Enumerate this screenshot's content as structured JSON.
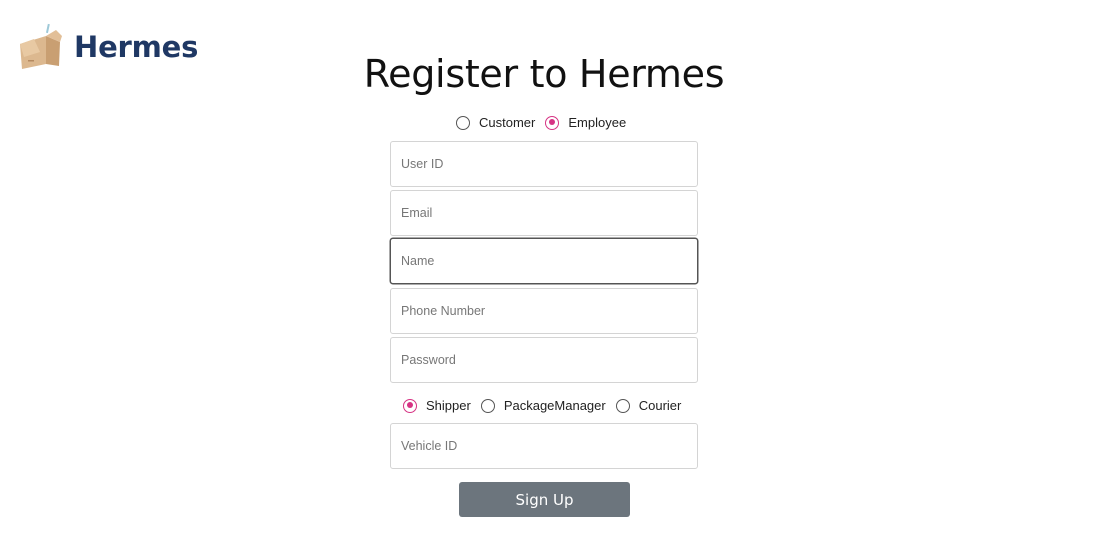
{
  "brand": {
    "name": "Hermes",
    "logo_icon": "cardboard-box-icon"
  },
  "page_title": "Register to Hermes",
  "account_type": {
    "options": [
      "Customer",
      "Employee"
    ],
    "selected": "Employee"
  },
  "fields": {
    "user_id": {
      "placeholder": "User ID",
      "value": ""
    },
    "email": {
      "placeholder": "Email",
      "value": ""
    },
    "name": {
      "placeholder": "Name",
      "value": ""
    },
    "phone": {
      "placeholder": "Phone Number",
      "value": ""
    },
    "password": {
      "placeholder": "Password",
      "value": ""
    },
    "vehicle_id": {
      "placeholder": "Vehicle ID",
      "value": ""
    }
  },
  "employee_role": {
    "options": [
      "Shipper",
      "PackageManager",
      "Courier"
    ],
    "selected": "Shipper"
  },
  "submit_label": "Sign Up",
  "colors": {
    "brand_text": "#1f3864",
    "radio_accent": "#d63384",
    "button_bg": "#6c757d",
    "box_tan": "#d9b48a"
  }
}
